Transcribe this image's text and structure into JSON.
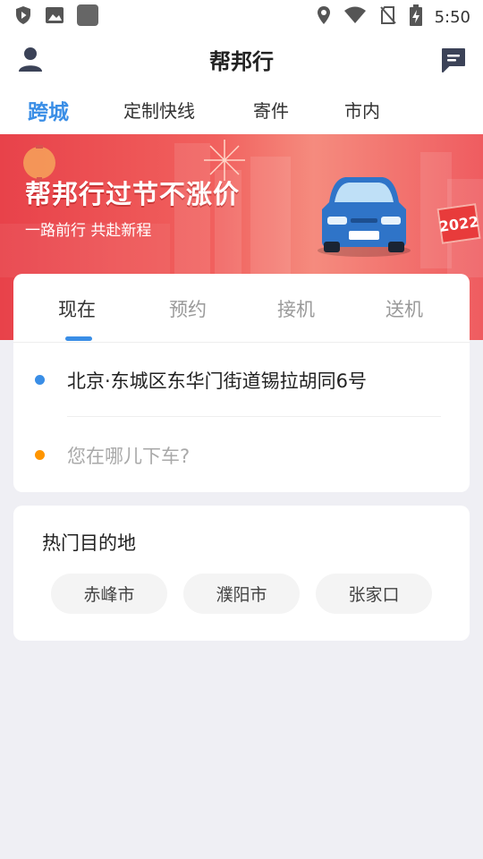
{
  "status_bar": {
    "time": "5:50",
    "left_icons": [
      "shield-play-icon",
      "image-icon",
      "app-square-icon"
    ],
    "right_icons": [
      "location-icon",
      "wifi-icon",
      "no-sim-icon",
      "battery-charging-icon"
    ]
  },
  "header": {
    "title": "帮邦行",
    "left_icon": "user-icon",
    "right_icon": "message-icon"
  },
  "top_tabs": [
    {
      "label": "跨城",
      "active": true
    },
    {
      "label": "定制快线",
      "active": false
    },
    {
      "label": "寄件",
      "active": false
    },
    {
      "label": "市内",
      "active": false
    }
  ],
  "banner": {
    "headline": "帮邦行过节不涨价",
    "subtitle": "一路前行 共赴新程",
    "year_sign": "2022"
  },
  "ride_modes": [
    {
      "label": "现在",
      "active": true
    },
    {
      "label": "预约",
      "active": false
    },
    {
      "label": "接机",
      "active": false
    },
    {
      "label": "送机",
      "active": false
    }
  ],
  "trip": {
    "from": "北京·东城区东华门街道锡拉胡同6号",
    "to_placeholder": "您在哪儿下车?"
  },
  "popular": {
    "title": "热门目的地",
    "items": [
      "赤峰市",
      "濮阳市",
      "张家口"
    ]
  },
  "colors": {
    "accent": "#3a8ee6",
    "origin_dot": "#3a8ee6",
    "destination_dot": "#ff9500",
    "banner_red": "#e8424a"
  }
}
